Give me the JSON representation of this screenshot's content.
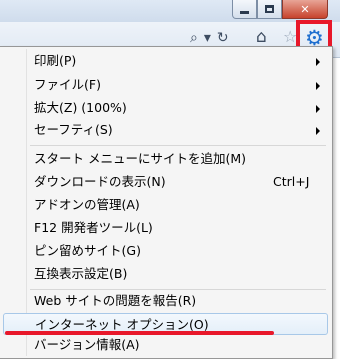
{
  "window": {
    "minimize_icon": "minimize-icon",
    "maximize_icon": "maximize-icon",
    "close_glyph": "✕"
  },
  "toolbar": {
    "search_glyph": "⌕",
    "dropdown_glyph": "▾",
    "refresh_glyph": "↻",
    "home_glyph": "⌂",
    "favorites_glyph": "☆",
    "tools_glyph": "⚙",
    "highlight_color": "#e8182a"
  },
  "menu": {
    "items": [
      {
        "label": "印刷(P)",
        "submenu": true
      },
      {
        "label": "ファイル(F)",
        "submenu": true
      },
      {
        "label": "拡大(Z) (100%)",
        "submenu": true
      },
      {
        "label": "セーフティ(S)",
        "submenu": true
      },
      {
        "label": "スタート メニューにサイトを追加(M)",
        "submenu": false
      },
      {
        "label": "ダウンロードの表示(N)",
        "shortcut": "Ctrl+J",
        "submenu": false
      },
      {
        "label": "アドオンの管理(A)",
        "submenu": false
      },
      {
        "label": "F12 開発者ツール(L)",
        "submenu": false
      },
      {
        "label": "ピン留めサイト(G)",
        "submenu": false
      },
      {
        "label": "互換表示設定(B)",
        "submenu": false
      },
      {
        "label": "Web サイトの問題を報告(R)",
        "submenu": false
      },
      {
        "label": "インターネット オプション(O)",
        "submenu": false
      },
      {
        "label": "バージョン情報(A)",
        "submenu": false
      }
    ],
    "highlighted_item": "インターネット オプション(O)",
    "hover_color": "#e4eff9",
    "underline_color": "#e8182a"
  }
}
